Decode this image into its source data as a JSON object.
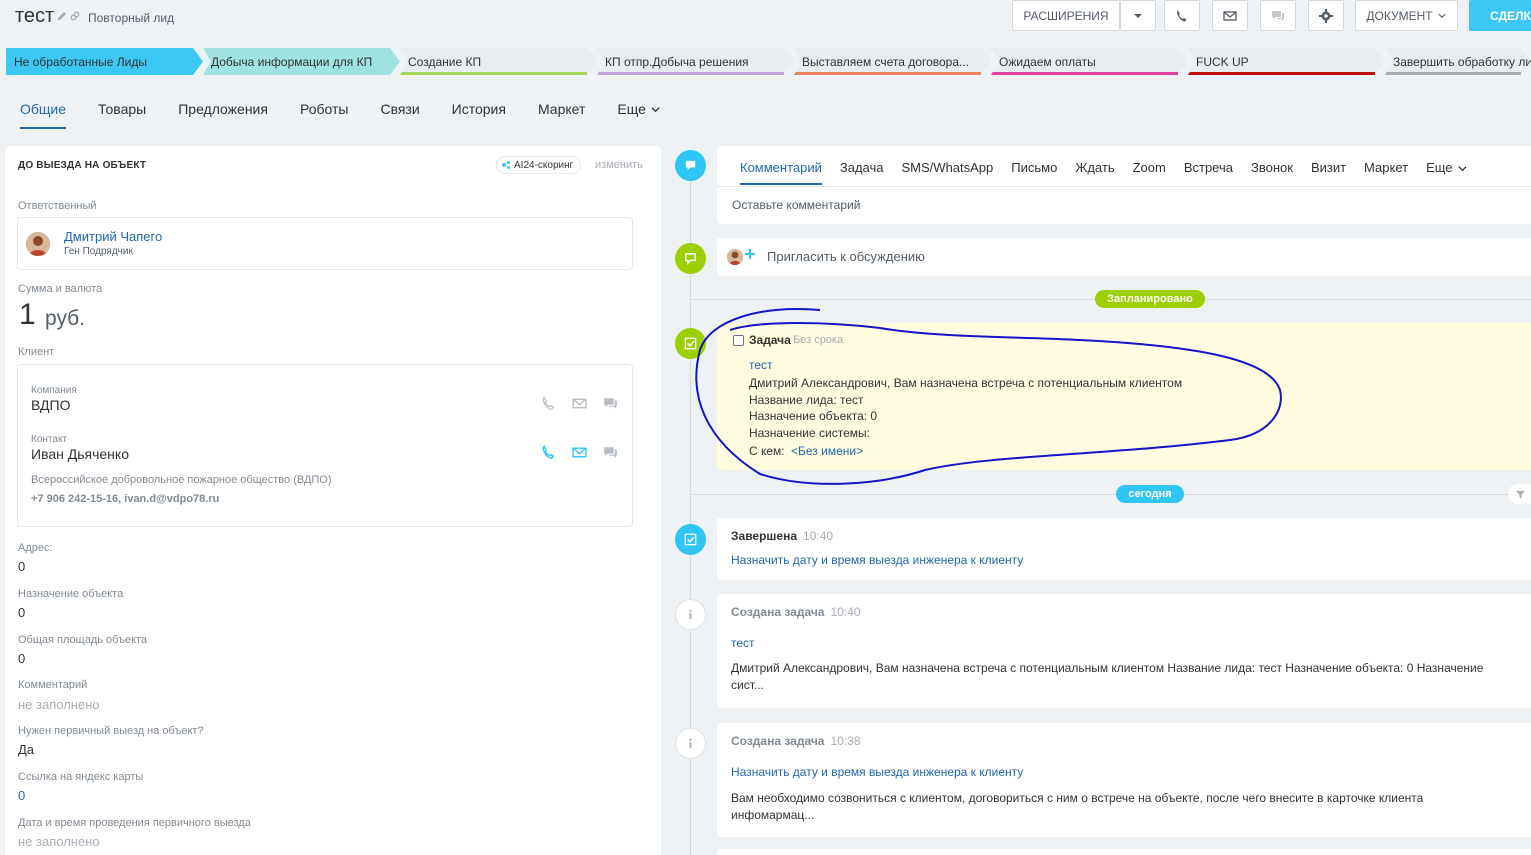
{
  "header": {
    "title": "тест",
    "subtitle": "Повторный лид",
    "buttons": {
      "extensions": "РАСШИРЕНИЯ",
      "document": "ДОКУМЕНТ",
      "deal": "СДЕЛКУ"
    }
  },
  "stages": [
    {
      "label": "Не обработанные Лиды",
      "bg": "#3bc8f5",
      "bar": "#3bc8f5"
    },
    {
      "label": "Добыча информации для КП",
      "bg": "#9ee3e0",
      "bar": "#9ee3e0"
    },
    {
      "label": "Создание КП",
      "bg": "#e9ecef",
      "bar": "#a3d65a"
    },
    {
      "label": "КП отпр.Добыча решения",
      "bg": "#e9ecef",
      "bar": "#c5a3e0"
    },
    {
      "label": "Выставляем счета договора...",
      "bg": "#e9ecef",
      "bar": "#f0825c"
    },
    {
      "label": "Ожидаем оплаты",
      "bg": "#e9ecef",
      "bar": "#e0439c"
    },
    {
      "label": "FUCK UP",
      "bg": "#e9ecef",
      "bar": "#c20d0d"
    },
    {
      "label": "Завершить обработку лида",
      "bg": "#e9ecef",
      "bar": "#a8adb4"
    }
  ],
  "tabs": [
    "Общие",
    "Товары",
    "Предложения",
    "Роботы",
    "Связи",
    "История",
    "Маркет",
    "Еще"
  ],
  "left": {
    "section_title": "ДО ВЫЕЗДА НА ОБЪЕКТ",
    "ai_label": "AI24-скоринг",
    "change_label": "изменить",
    "responsible_label": "Ответственный",
    "responsible_name": "Дмитрий Чапего",
    "responsible_role": "Ген Подрядчик",
    "amount_label": "Сумма и валюта",
    "amount_value": "1",
    "amount_currency": "руб.",
    "client_label": "Клиент",
    "company_label": "Компания",
    "company_value": "ВДПО",
    "contact_label": "Контакт",
    "contact_value": "Иван Дьяченко",
    "contact_org": "Всероссийское добровольное пожарное общество (ВДПО)",
    "contact_phone_email": "+7 906 242-15-16, ivan.d@vdpo78.ru",
    "fields": [
      {
        "label": "Адрес:",
        "value": "0",
        "style": ""
      },
      {
        "label": "Назначение объекта",
        "value": "0",
        "style": ""
      },
      {
        "label": "Общая площадь объекта",
        "value": "0",
        "style": ""
      },
      {
        "label": "Комментарий",
        "value": "не заполнено",
        "style": "muted"
      },
      {
        "label": "Нужен первичный выезд на объект?",
        "value": "Да",
        "style": ""
      },
      {
        "label": "Ссылка на яндекс карты",
        "value": "0",
        "style": "link"
      },
      {
        "label": "Дата и время проведения первичного выезда",
        "value": "не заполнено",
        "style": "muted"
      }
    ]
  },
  "timeline": {
    "editor_tabs": [
      "Комментарий",
      "Задача",
      "SMS/WhatsApp",
      "Письмо",
      "Ждать",
      "Zoom",
      "Встреча",
      "Звонок",
      "Визит",
      "Маркет",
      "Еще"
    ],
    "editor_placeholder": "Оставьте комментарий",
    "invite_text": "Пригласить к обсуждению",
    "planned_label": "Запланировано",
    "today_label": "сегодня",
    "task": {
      "title": "Задача",
      "deadline": "Без срока",
      "link": "тест",
      "lines": [
        "Дмитрий Александрович, Вам назначена встреча с потенциальным клиентом",
        "Название лида: тест",
        "Назначение объекта: 0",
        "Назначение системы:"
      ],
      "with_label": "С кем:",
      "with_value": "<Без имени>"
    },
    "completed": {
      "title": "Завершена",
      "time": "10:40",
      "link": "Назначить дату и время выезда инженера к клиенту"
    },
    "created1": {
      "title": "Создана задача",
      "time": "10:40",
      "link": "тест",
      "text": "Дмитрий Александрович, Вам назначена встреча с потенциальным клиентом Название лида: тест Назначение объекта: 0 Назначение сист..."
    },
    "created2": {
      "title": "Создана задача",
      "time": "10:38",
      "link": "Назначить дату и время выезда инженера к клиенту",
      "text": "Вам необходимо созвониться с клиентом, договориться с ним о встрече на объекте, после чего внесите в карточке клиента инфомармац..."
    }
  },
  "colors": {
    "accent": "#3bc8f5",
    "link": "#2067b0",
    "green": "#9dcf00",
    "annotation": "#1414c8"
  }
}
